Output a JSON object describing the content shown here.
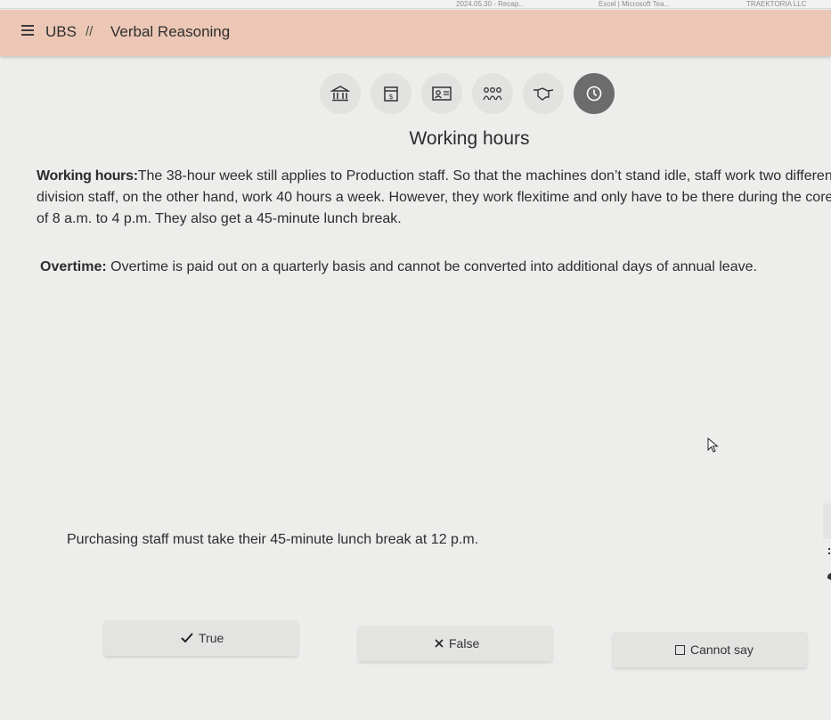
{
  "os_strip": {
    "items": [
      "2024.05.30 - Recap...",
      "Excel | Microsoft Tea...",
      "TRAEKTORIA LLC"
    ]
  },
  "header": {
    "brand": "UBS",
    "separator": "//",
    "section": "Verbal Reasoning",
    "background": "#ecc7b5"
  },
  "icon_bar": {
    "icons": [
      "bank-icon",
      "money-box-icon",
      "id-card-icon",
      "team-icon",
      "handshake-icon",
      "clock-icon"
    ],
    "active_index": 5
  },
  "content": {
    "title": "Working hours",
    "working_hours_label": "Working hours:",
    "working_hours_lines": [
      "The 38-hour week still applies to Production staff. So that the machines don’t stand idle, staff work two different sh",
      "division staff, on the other hand, work 40 hours a week. However, they work flexitime and only have to be there during the core wor",
      "of 8 a.m. to 4 p.m. They also get a 45-minute lunch break."
    ],
    "overtime_label": "Overtime:",
    "overtime_text": " Overtime is paid out on a quarterly basis and cannot be converted into additional days of annual leave."
  },
  "question": {
    "statement": "Purchasing staff must take their 45-minute lunch break at 12 p.m."
  },
  "answers": {
    "true_label": "True",
    "false_label": "False",
    "cannot_say_label": "Cannot say"
  }
}
